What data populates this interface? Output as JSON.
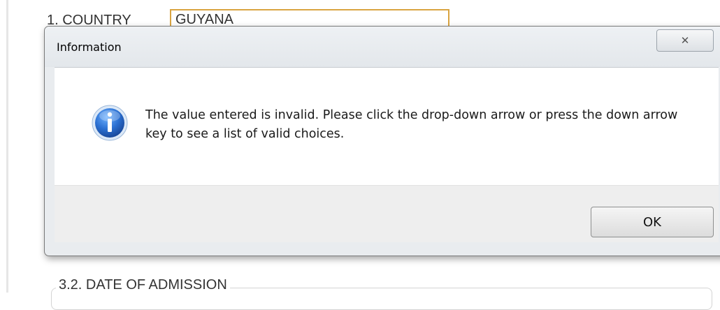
{
  "form": {
    "country_label": "1. COUNTRY",
    "country_value": "GUYANA",
    "section_title": "3.2. DATE OF ADMISSION"
  },
  "dialog": {
    "title": "Information",
    "close_glyph": "✕",
    "icon": "info-icon",
    "message": "The value entered is invalid. Please click the drop-down arrow or press the down arrow key to see a list of valid choices.",
    "ok_label": "OK"
  },
  "colors": {
    "input_border": "#d9a441",
    "info_icon_blue": "#1f5fbf"
  }
}
